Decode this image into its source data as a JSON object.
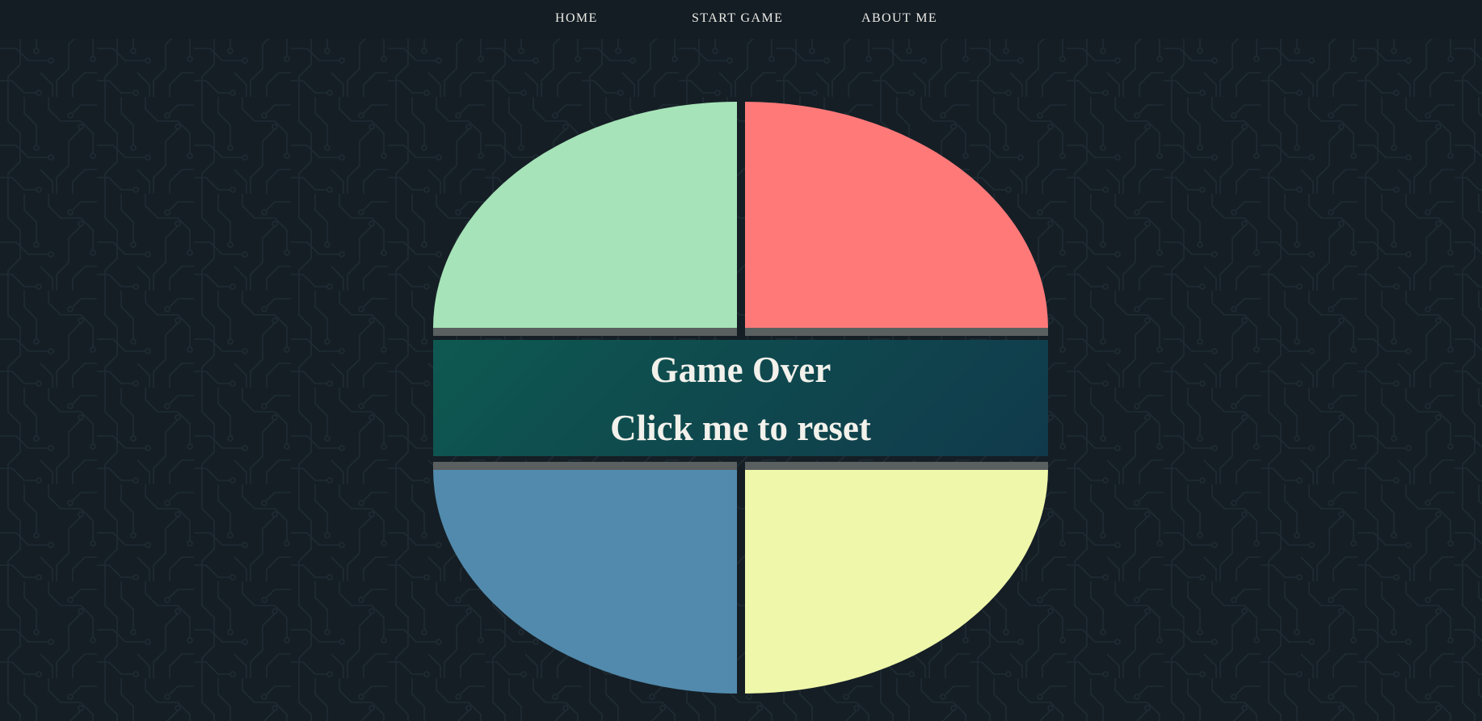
{
  "nav": {
    "items": [
      {
        "label": "HOME"
      },
      {
        "label": "START GAME"
      },
      {
        "label": "ABOUT ME"
      }
    ]
  },
  "game": {
    "status_text": "Game Over",
    "reset_text": "Click me to reset",
    "pads": [
      {
        "name": "green",
        "color": "#a6e3b8"
      },
      {
        "name": "red",
        "color": "#ff7979"
      },
      {
        "name": "blue",
        "color": "#518aac"
      },
      {
        "name": "yellow",
        "color": "#eff7aa"
      }
    ]
  },
  "theme": {
    "background": "#151e25",
    "reset_bar_color": "#0f4a4e",
    "text_color": "#ecebe6"
  }
}
